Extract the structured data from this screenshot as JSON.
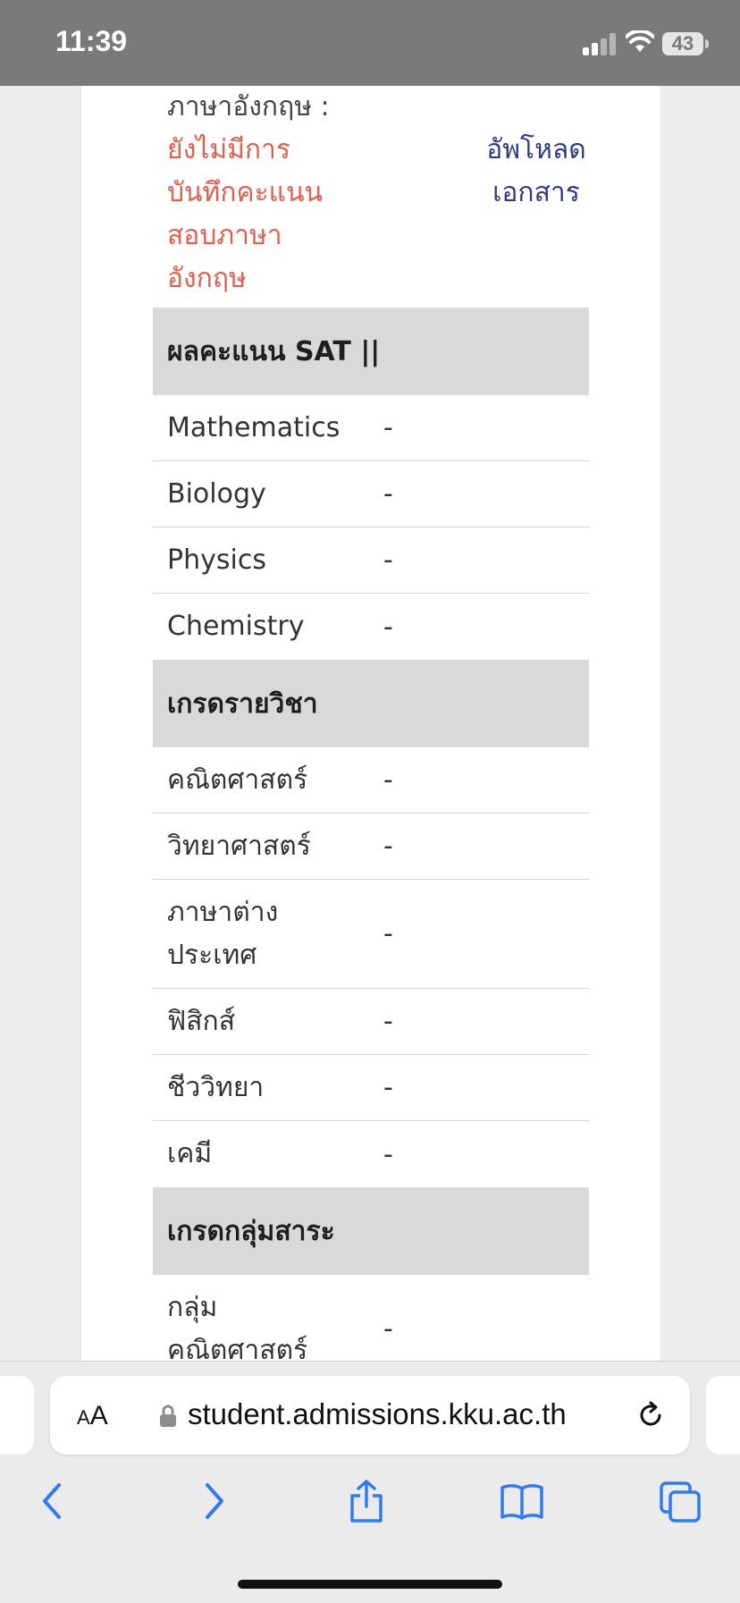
{
  "status_bar": {
    "time": "11:39",
    "battery": "43"
  },
  "english_score": {
    "label": "ภาษาอังกฤษ :",
    "status_lines": [
      "ยังไม่มีการ",
      "บันทึกคะแนน",
      "สอบภาษา",
      "อังกฤษ"
    ],
    "upload_lines": [
      "อัพโหลด",
      "เอกสาร"
    ]
  },
  "sat2": {
    "header": "ผลคะแนน SAT ||",
    "rows": [
      {
        "label": "Mathematics",
        "value": "-"
      },
      {
        "label": "Biology",
        "value": "-"
      },
      {
        "label": "Physics",
        "value": "-"
      },
      {
        "label": "Chemistry",
        "value": "-"
      }
    ]
  },
  "subject_grades": {
    "header": "เกรดรายวิชา",
    "rows": [
      {
        "label": "คณิตศาสตร์",
        "value": "-"
      },
      {
        "label": "วิทยาศาสตร์",
        "value": "-"
      },
      {
        "label_lines": [
          "ภาษาต่าง",
          "ประเทศ"
        ],
        "value": "-"
      },
      {
        "label": "ฟิสิกส์",
        "value": "-"
      },
      {
        "label": "ชีววิทยา",
        "value": "-"
      },
      {
        "label": "เคมี",
        "value": "-"
      }
    ]
  },
  "group_grades": {
    "header": "เกรดกลุ่มสาระ",
    "rows": [
      {
        "label_lines": [
          "กลุ่ม",
          "คณิตศาสตร์"
        ],
        "value": "-"
      }
    ]
  },
  "browser": {
    "aa_label_small": "A",
    "aa_label_large": "A",
    "url": "student.admissions.kku.ac.th"
  },
  "icons": {
    "lock": "lock-icon",
    "reload": "reload-icon",
    "back": "chevron-left-icon",
    "forward": "chevron-right-icon",
    "share": "share-icon",
    "bookmarks": "book-icon",
    "tabs": "tabs-icon"
  },
  "colors": {
    "status_text_red": "#e85c4a",
    "link_blue": "#2d3a86",
    "section_header_bg": "#d9d9d9",
    "ios_blue": "#2f7bf6"
  }
}
